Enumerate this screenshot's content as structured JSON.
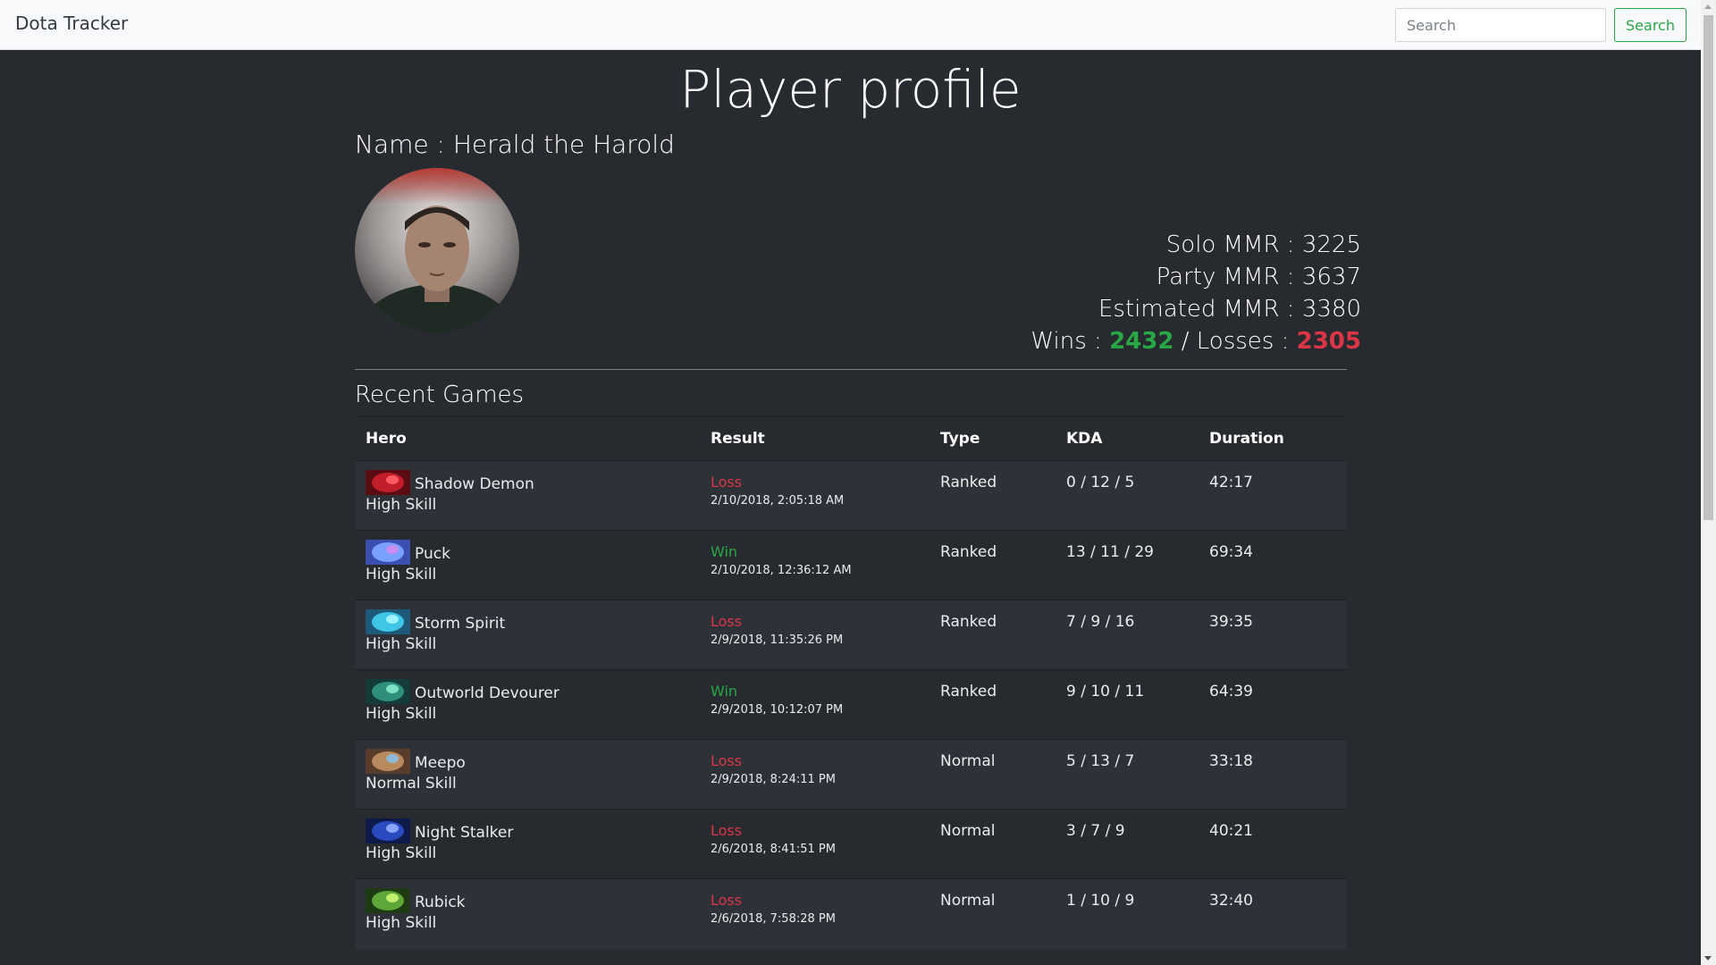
{
  "nav": {
    "brand": "Dota Tracker",
    "search_placeholder": "Search",
    "search_button": "Search"
  },
  "profile": {
    "title": "Player profile",
    "name_line": "Name : Herald the Harold",
    "solo_mmr_line": "Solo MMR : 3225",
    "party_mmr_line": "Party MMR : 3637",
    "estimated_mmr_line": "Estimated MMR : 3380",
    "wins_label": "Wins : ",
    "wins": "2432",
    "separator": " / ",
    "losses_label": "Losses : ",
    "losses": "2305"
  },
  "recent": {
    "title": "Recent Games",
    "columns": [
      "Hero",
      "Result",
      "Type",
      "KDA",
      "Duration"
    ],
    "rows": [
      {
        "hero": "Shadow Demon",
        "skill": "High Skill",
        "result": "Loss",
        "date": "2/10/2018, 2:05:18 AM",
        "type": "Ranked",
        "kda": "0 / 12 / 5",
        "duration": "42:17"
      },
      {
        "hero": "Puck",
        "skill": "High Skill",
        "result": "Win",
        "date": "2/10/2018, 12:36:12 AM",
        "type": "Ranked",
        "kda": "13 / 11 / 29",
        "duration": "69:34"
      },
      {
        "hero": "Storm Spirit",
        "skill": "High Skill",
        "result": "Loss",
        "date": "2/9/2018, 11:35:26 PM",
        "type": "Ranked",
        "kda": "7 / 9 / 16",
        "duration": "39:35"
      },
      {
        "hero": "Outworld Devourer",
        "skill": "High Skill",
        "result": "Win",
        "date": "2/9/2018, 10:12:07 PM",
        "type": "Ranked",
        "kda": "9 / 10 / 11",
        "duration": "64:39"
      },
      {
        "hero": "Meepo",
        "skill": "Normal Skill",
        "result": "Loss",
        "date": "2/9/2018, 8:24:11 PM",
        "type": "Normal",
        "kda": "5 / 13 / 7",
        "duration": "33:18"
      },
      {
        "hero": "Night Stalker",
        "skill": "High Skill",
        "result": "Loss",
        "date": "2/6/2018, 8:41:51 PM",
        "type": "Normal",
        "kda": "3 / 7 / 9",
        "duration": "40:21"
      },
      {
        "hero": "Rubick",
        "skill": "High Skill",
        "result": "Loss",
        "date": "2/6/2018, 7:58:28 PM",
        "type": "Normal",
        "kda": "1 / 10 / 9",
        "duration": "32:40"
      }
    ]
  },
  "colors": {
    "win": "#28a745",
    "loss": "#dc3545",
    "background": "#272b30",
    "stripe": "#2e3238"
  },
  "hero_icons": [
    "shadow-demon-icon",
    "puck-icon",
    "storm-spirit-icon",
    "outworld-devourer-icon",
    "meepo-icon",
    "night-stalker-icon",
    "rubick-icon"
  ]
}
